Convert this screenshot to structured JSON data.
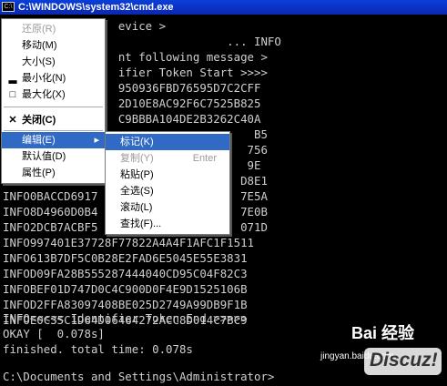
{
  "window": {
    "title": "C:\\WINDOWS\\system32\\cmd.exe",
    "icon_text": "C:\\"
  },
  "console": {
    "lines": [
      "                 evice >",
      "                                 ... INFO",
      "                 nt following message >",
      "                 ifier Token Start >>>>",
      "                 950936FBD76595D7C2CFF",
      "                 2D10E8AC92F6C7525B825",
      "                 C9BBBA104DE2B3262C40A",
      "                                     B5",
      "                                    756",
      "                                    9E",
      "                                   D8E1",
      "INFO0BACCD6917                     7E5A",
      "INFO8D4960D0B4                     7E0B",
      "INFO2DCB7ACBF5                     071D",
      "INFO997401E37728F77822A4A4F1AFC1F1511",
      "INFO613B7DF5C0B28E2FAD6E5045E55E3831",
      "INFOD09FA28B555287444040CD95C04F82C3",
      "INFOBEF01D747D0C4C900D0F4E9D1525106B",
      "INFOD2FFA83097408BE025D2749A99DB9F1B",
      "INFOE0C35C1D64D06464272ACC8D014C7BC9",
      "INFO<<<<< Identifier Token End >>>>>",
      "OKAY [  0.078s]",
      "finished. total time: 0.078s",
      "",
      "C:\\Documents and Settings\\Administrator>"
    ]
  },
  "system_menu": {
    "items": [
      {
        "icon": "",
        "label": "还原(R)",
        "disabled": true
      },
      {
        "icon": "",
        "label": "移动(M)",
        "disabled": false
      },
      {
        "icon": "",
        "label": "大小(S)",
        "disabled": false
      },
      {
        "icon": "▂",
        "label": "最小化(N)",
        "disabled": false
      },
      {
        "icon": "□",
        "label": "最大化(X)",
        "disabled": false
      },
      {
        "icon": "✕",
        "label": "关闭(C)",
        "disabled": false
      },
      {
        "icon": "",
        "label": "编辑(E)",
        "disabled": false,
        "submenu_arrow": "▸"
      },
      {
        "icon": "",
        "label": "默认值(D)",
        "disabled": false
      },
      {
        "icon": "",
        "label": "属性(P)",
        "disabled": false
      }
    ]
  },
  "edit_submenu": {
    "items": [
      {
        "label": "标记(K)",
        "shortcut": "",
        "disabled": false
      },
      {
        "label": "复制(Y)",
        "shortcut": "Enter",
        "disabled": true
      },
      {
        "label": "粘贴(P)",
        "shortcut": "",
        "disabled": false
      },
      {
        "label": "全选(S)",
        "shortcut": "",
        "disabled": false
      },
      {
        "label": "滚动(L)",
        "shortcut": "",
        "disabled": false
      },
      {
        "label": "查找(F)...",
        "shortcut": "",
        "disabled": false
      }
    ]
  },
  "watermark": {
    "baidu": "Bai 经验",
    "url": "jingyan.baidu.com",
    "discuz": "Discuz!"
  },
  "colors": {
    "titlebar": "#0a3fd8",
    "menu_highlight": "#316ac5",
    "console_text": "#d0d0d0"
  }
}
